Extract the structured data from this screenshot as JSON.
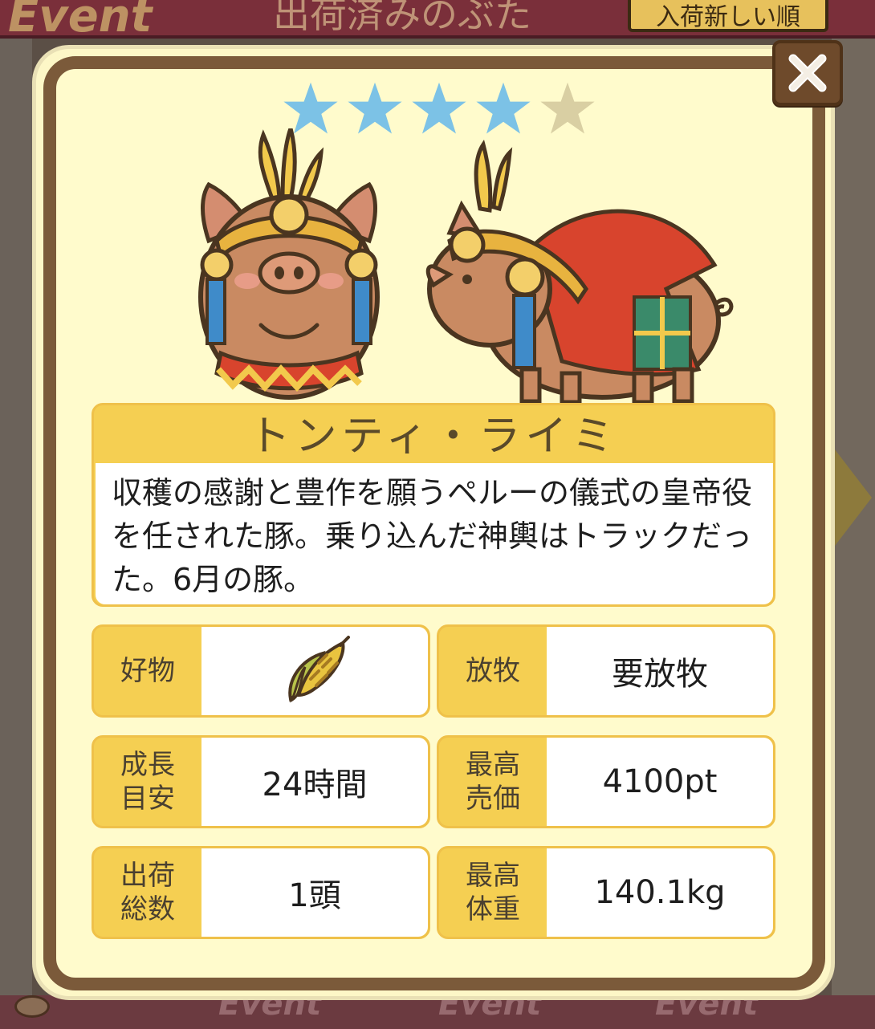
{
  "background": {
    "event_label": "Event",
    "header_title": "出荷済みのぶた",
    "sort_button": "入荷新しい順"
  },
  "close_button": {
    "label": "×"
  },
  "rating": {
    "stars_filled": 4,
    "stars_total": 5,
    "filled_color": "#7cc2e6",
    "empty_color": "#d9cfa3"
  },
  "pig": {
    "name": "トンティ・ライミ",
    "description": "収穫の感謝と豊作を願うペルーの儀式の皇帝役を任された豚。乗り込んだ神輿はトラックだった。6月の豚。"
  },
  "stats": {
    "favorite_label": "好物",
    "favorite_icon": "corn-icon",
    "grazing_label": "放牧",
    "grazing_value": "要放牧",
    "growth_label": "成長目安",
    "growth_value": "24時間",
    "max_price_label": "最高売価",
    "max_price_value": "4100pt",
    "shipped_label": "出荷総数",
    "shipped_value": "1頭",
    "max_weight_label": "最高体重",
    "max_weight_value": "140.1kg"
  },
  "colors": {
    "card_yellow": "#f5cf52",
    "frame_brown": "#7b5a3a",
    "panel_cream": "#fffbcc"
  }
}
